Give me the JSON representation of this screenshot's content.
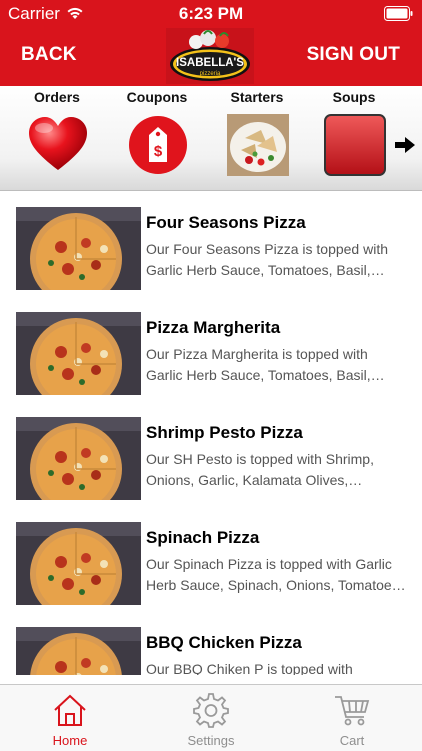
{
  "status_bar": {
    "carrier": "Carrier",
    "time": "6:23 PM"
  },
  "header": {
    "back_label": "BACK",
    "signout_label": "SIGN OUT",
    "logo_text": "ISABELLA'S pizzeria"
  },
  "categories": [
    {
      "label": "Orders",
      "icon": "heart-icon"
    },
    {
      "label": "Coupons",
      "icon": "price-tag-icon"
    },
    {
      "label": "Starters",
      "icon": "starters-thumbnail"
    },
    {
      "label": "Soups",
      "icon": "soups-thumbnail"
    }
  ],
  "items": [
    {
      "title": "Four Seasons Pizza",
      "description": "Our Four Seasons Pizza is topped with Garlic Herb Sauce, Tomatoes, Basil, Gree…"
    },
    {
      "title": "Pizza Margherita",
      "description": "Our Pizza Margherita is topped with Garlic Herb Sauce, Tomatoes, Basil, Fresh Mozz…"
    },
    {
      "title": "Shrimp Pesto Pizza",
      "description": "Our SH Pesto  is topped with Shrimp, Onions, Garlic, Kalamata Olives, Tomatoe…"
    },
    {
      "title": "Spinach Pizza",
      "description": "Our Spinach Pizza is topped with Garlic Herb Sauce, Spinach, Onions, Tomatoe…"
    },
    {
      "title": "BBQ Chicken Pizza",
      "description": "Our BBQ Chiken P is topped with Chicken…"
    }
  ],
  "tabs": [
    {
      "label": "Home",
      "icon": "home-icon",
      "active": true
    },
    {
      "label": "Settings",
      "icon": "gear-icon",
      "active": false
    },
    {
      "label": "Cart",
      "icon": "cart-icon",
      "active": false
    }
  ],
  "colors": {
    "brand_red": "#d9141c",
    "tab_inactive": "#8e8e8e"
  }
}
